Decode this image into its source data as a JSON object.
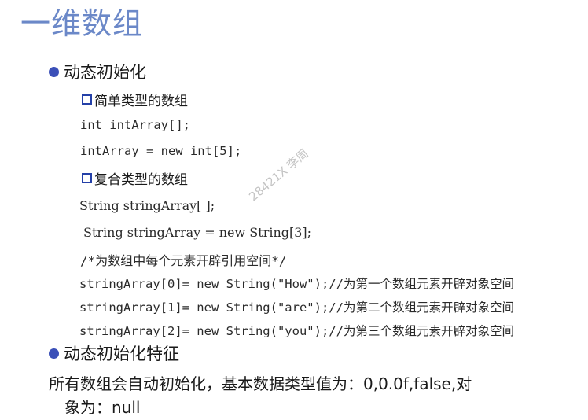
{
  "title": "一维数组",
  "sections": [
    {
      "bullet": "动态初始化",
      "subsections": [
        {
          "label": "简单类型的数组",
          "lines": [
            "int intArray[];",
            "intArray = new int[5];"
          ]
        },
        {
          "label": "复合类型的数组",
          "lines": [
            "String stringArray[ ];",
            "String stringArray = new String[3];",
            "/*为数组中每个元素开辟引用空间*/",
            "stringArray[0]= new String(\"How\");//为第一个数组元素开辟对象空间",
            "stringArray[1]= new String(\"are\");//为第二个数组元素开辟对象空间",
            "stringArray[2]= new String(\"you\");//为第三个数组元素开辟对象空间"
          ]
        }
      ]
    },
    {
      "bullet": "动态初始化特征",
      "paragraph": [
        "所有数组会自动初始化，基本数据类型值为：0,0.0f,false,对",
        "象为：null"
      ]
    }
  ],
  "watermark": "28421X 李周",
  "colors": {
    "title": "#6b88c8",
    "bullet": "#3b50b8",
    "square": "#2440a8",
    "watermark": "#c4c4c4"
  },
  "icons": {
    "bullet": "filled-circle",
    "sub_bullet": "hollow-square"
  }
}
